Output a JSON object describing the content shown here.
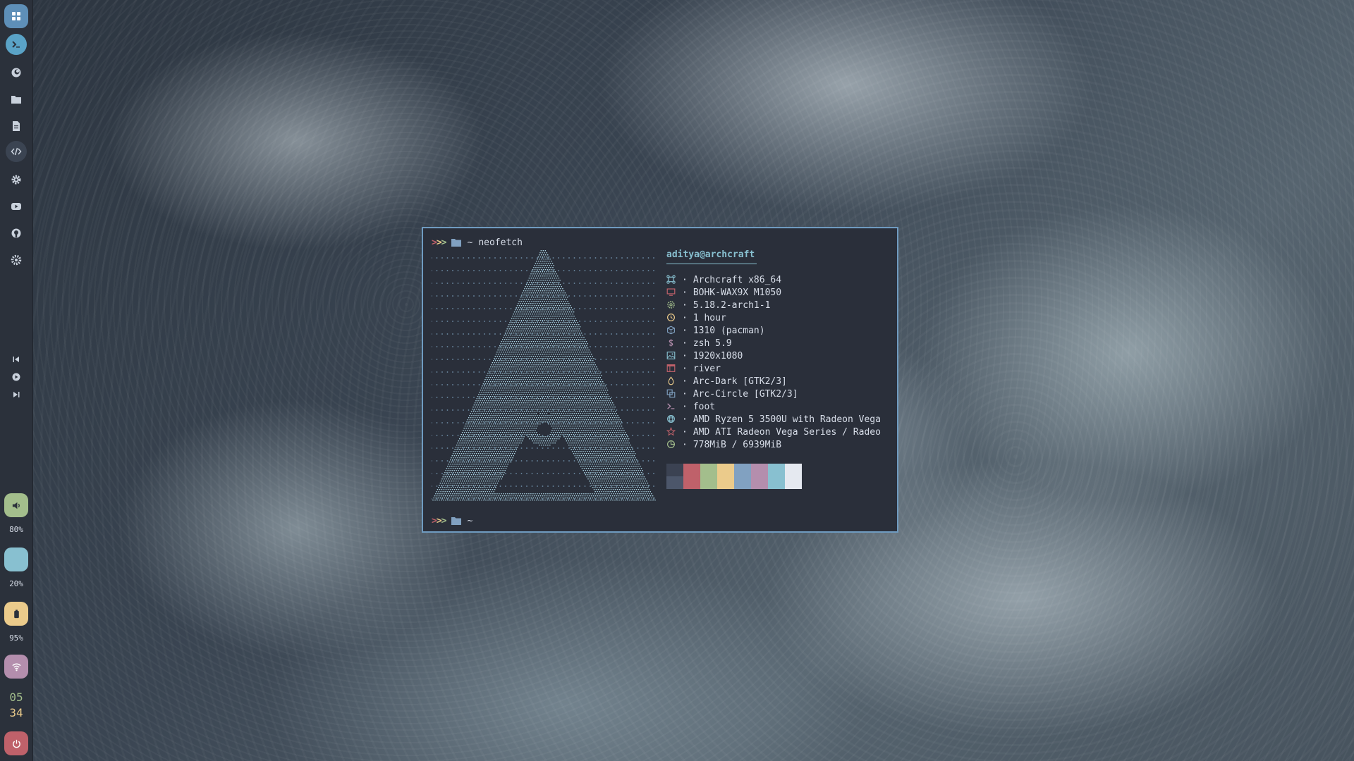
{
  "sidebar": {
    "apps": [
      {
        "name": "app-grid-icon"
      },
      {
        "name": "terminal-icon"
      },
      {
        "name": "browser-icon"
      },
      {
        "name": "folder-icon"
      },
      {
        "name": "document-icon"
      },
      {
        "name": "code-icon"
      },
      {
        "name": "gear-icon"
      },
      {
        "name": "youtube-icon"
      },
      {
        "name": "github-icon"
      },
      {
        "name": "settings-cog-icon"
      }
    ],
    "media": [
      "previous-icon",
      "play-icon",
      "next-icon"
    ],
    "volume": {
      "percent": "80%",
      "color": "#a3be8c"
    },
    "brightness": {
      "percent": "20%",
      "color": "#88c0d0"
    },
    "battery": {
      "percent": "95%",
      "color": "#ebcb8b"
    },
    "wifi": {
      "color": "#b48ead"
    },
    "clock": {
      "hours": "05",
      "minutes": "34",
      "hours_color": "#a3be8c",
      "minutes_color": "#ebcb8b"
    },
    "power": {
      "color": "#bf616a"
    }
  },
  "terminal": {
    "command_line": {
      "path": "~",
      "command": "neofetch"
    },
    "user_host": "aditya@archcraft",
    "info": [
      {
        "icon": "command-icon",
        "color": "#88c0d0",
        "text": "Archcraft x86_64"
      },
      {
        "icon": "monitor-icon",
        "color": "#bf616a",
        "text": "BOHK-WAX9X M1050"
      },
      {
        "icon": "kernel-gear-icon",
        "color": "#a3be8c",
        "text": "5.18.2-arch1-1"
      },
      {
        "icon": "clock-icon",
        "color": "#ebcb8b",
        "text": "1 hour"
      },
      {
        "icon": "package-icon",
        "color": "#81a1c1",
        "text": "1310 (pacman)"
      },
      {
        "icon": "dollar-icon",
        "color": "#b48ead",
        "text": "zsh 5.9"
      },
      {
        "icon": "image-icon",
        "color": "#88c0d0",
        "text": "1920x1080"
      },
      {
        "icon": "window-icon",
        "color": "#bf616a",
        "text": "river"
      },
      {
        "icon": "drop-icon",
        "color": "#ebcb8b",
        "text": "Arc-Dark [GTK2/3]"
      },
      {
        "icon": "copy-icon",
        "color": "#81a1c1",
        "text": "Arc-Circle [GTK2/3]"
      },
      {
        "icon": "prompt-icon",
        "color": "#b48ead",
        "text": "foot"
      },
      {
        "icon": "cpu-icon",
        "color": "#88c0d0",
        "text": "AMD Ryzen 5 3500U with Radeon Vega"
      },
      {
        "icon": "star-icon",
        "color": "#bf616a",
        "text": "AMD ATI Radeon Vega Series / Radeo"
      },
      {
        "icon": "pie-icon",
        "color": "#a3be8c",
        "text": "778MiB / 6939MiB"
      }
    ],
    "palette": [
      "#3b4252",
      "#bf616a",
      "#a3be8c",
      "#ebcb8b",
      "#81a1c1",
      "#b48ead",
      "#88c0d0",
      "#e5e9f0"
    ],
    "prompt_path": "~"
  }
}
